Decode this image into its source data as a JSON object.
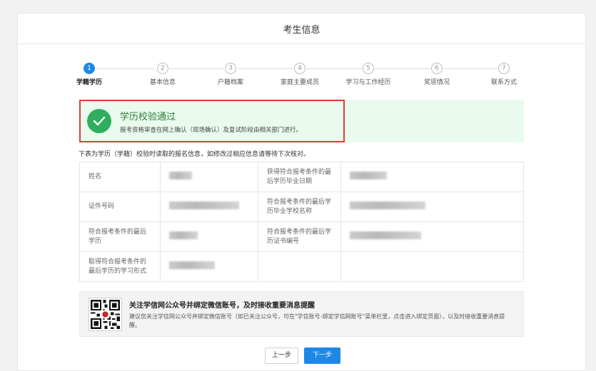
{
  "header": {
    "title": "考生信息"
  },
  "steps": [
    {
      "num": "1",
      "label": "学籍学历",
      "active": true
    },
    {
      "num": "2",
      "label": "基本信息"
    },
    {
      "num": "3",
      "label": "户籍档案"
    },
    {
      "num": "4",
      "label": "家庭主要成员"
    },
    {
      "num": "5",
      "label": "学习与工作经历"
    },
    {
      "num": "6",
      "label": "奖惩情况"
    },
    {
      "num": "7",
      "label": "联系方式"
    }
  ],
  "success": {
    "title": "学历校验通过",
    "subtitle": "报考资格审查在网上确认（现场确认）及复试阶段由相关部门进行。"
  },
  "note": "下表为学历（学籍）校验时读取的报名信息，如修改过相应信息请等待下次核对。",
  "table": {
    "rows": [
      {
        "label1": "姓名",
        "label2": "获得符合报考条件的最后学历毕业日期"
      },
      {
        "label1": "证件号码",
        "label2": "符合报考条件的最后学历毕业学校名称"
      },
      {
        "label1": "符合报考条件的最后学历",
        "label2": "符合报考条件的最后学历证书编号"
      },
      {
        "label1": "取得符合报考条件的最后学历的学习形式",
        "label2": ""
      }
    ]
  },
  "wechat": {
    "title": "关注学信网公众号并绑定微信账号，及时接收重要消息提醒",
    "desc": "建议您关注学信网公众号并绑定微信账号（如已关注公众号，可在\"学信账号-绑定学信网账号\"菜单栏里，点击进入绑定页面），以及时接收重要消息提醒。"
  },
  "buttons": {
    "prev": "上一步",
    "next": "下一步"
  },
  "colors": {
    "primary": "#1e88e5",
    "success": "#2fae5e",
    "highlight_border": "#e53935",
    "success_bg": "#e9fbee"
  }
}
